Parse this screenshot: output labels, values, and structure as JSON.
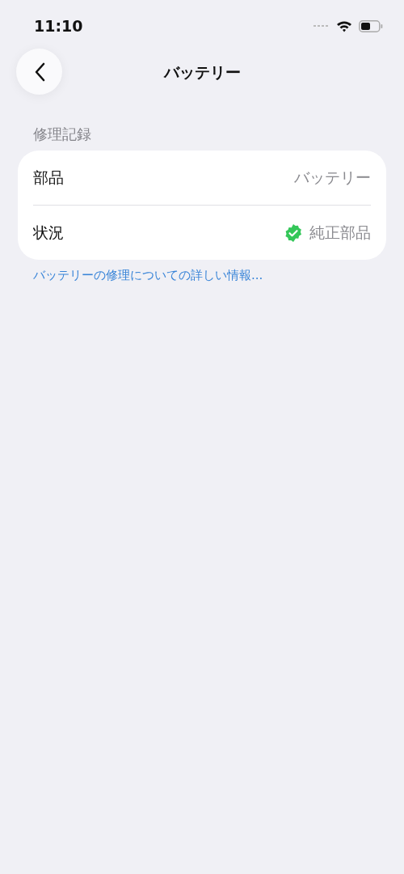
{
  "status_bar": {
    "time": "11:10"
  },
  "nav": {
    "title": "バッテリー"
  },
  "section": {
    "header": "修理記録",
    "rows": [
      {
        "kind": "text",
        "label": "部品",
        "value": "バッテリー"
      },
      {
        "kind": "verified",
        "label": "状況",
        "value": "純正部品"
      }
    ],
    "footer_link": "バッテリーの修理についての詳しい情報..."
  }
}
